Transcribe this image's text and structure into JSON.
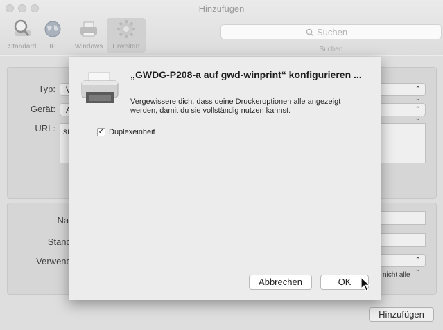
{
  "window": {
    "title": "Hinzufügen"
  },
  "toolbar": {
    "items": [
      {
        "label": "Standard",
        "icon": "magnifier-icon"
      },
      {
        "label": "IP",
        "icon": "globe-icon"
      },
      {
        "label": "Windows",
        "icon": "windows-printer-icon"
      },
      {
        "label": "Erweitert",
        "icon": "gear-icon"
      }
    ],
    "active": "Erweitert"
  },
  "search": {
    "placeholder": "Suchen",
    "caption": "Suchen"
  },
  "form": {
    "typ_label": "Typ:",
    "typ_value_visible": "V",
    "geraet_label": "Gerät:",
    "geraet_value_visible": "A",
    "url_label": "URL:",
    "url_value_visible": "sı",
    "name_label_visible": "Nam",
    "standort_label_visible": "Stando",
    "verwenden_label_visible": "Verwende",
    "note_visible": "nicht alle"
  },
  "add_button": {
    "label": "Hinzufügen"
  },
  "sheet": {
    "title": "„GWDG-P208-a auf gwd-winprint“ konfigurieren ...",
    "description": "Vergewissere dich, dass deine Druckeroptionen alle angezeigt werden, damit du sie vollständig nutzen kannst.",
    "option": {
      "label": "Duplexeinheit",
      "checked": true,
      "mark": "✓"
    },
    "cancel_label": "Abbrechen",
    "ok_label": "OK"
  },
  "colors": {
    "accent": "#b8b8b8",
    "background": "#ececec"
  }
}
